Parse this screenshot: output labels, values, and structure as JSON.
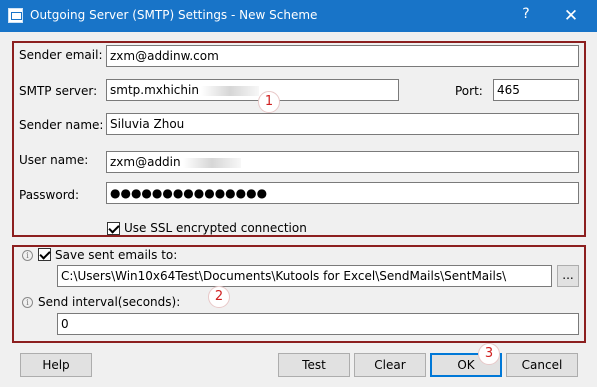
{
  "window": {
    "title": "Outgoing Server (SMTP) Settings - New Scheme",
    "help_glyph": "?",
    "close_glyph": "✕"
  },
  "server": {
    "sender_email_label": "Sender email:",
    "sender_email_value": "zxm@addinw.com",
    "smtp_server_label": "SMTP server:",
    "smtp_server_value": "smtp.mxhichin",
    "port_label": "Port:",
    "port_value": "465",
    "sender_name_label": "Sender name:",
    "sender_name_value": "Siluvia Zhou",
    "user_name_label": "User name:",
    "user_name_value": "zxm@addin",
    "password_label": "Password:",
    "password_value": "●●●●●●●●●●●●●●●",
    "ssl_label": "Use SSL encrypted connection",
    "ssl_checked": true
  },
  "save": {
    "save_sent_label": "Save sent emails to:",
    "save_sent_checked": true,
    "path_value": "C:\\Users\\Win10x64Test\\Documents\\Kutools for Excel\\SendMails\\SentMails\\",
    "browse_label": "...",
    "interval_label": "Send interval(seconds):",
    "interval_value": "0",
    "info_glyph": "i"
  },
  "annotations": {
    "step1": "1",
    "step2": "2",
    "step3": "3"
  },
  "buttons": {
    "help": "Help",
    "test": "Test",
    "clear": "Clear",
    "ok": "OK",
    "cancel": "Cancel"
  },
  "colors": {
    "titlebar": "#1874c8",
    "highlight_frame": "#8c1f1f",
    "annotation": "#d02020"
  }
}
